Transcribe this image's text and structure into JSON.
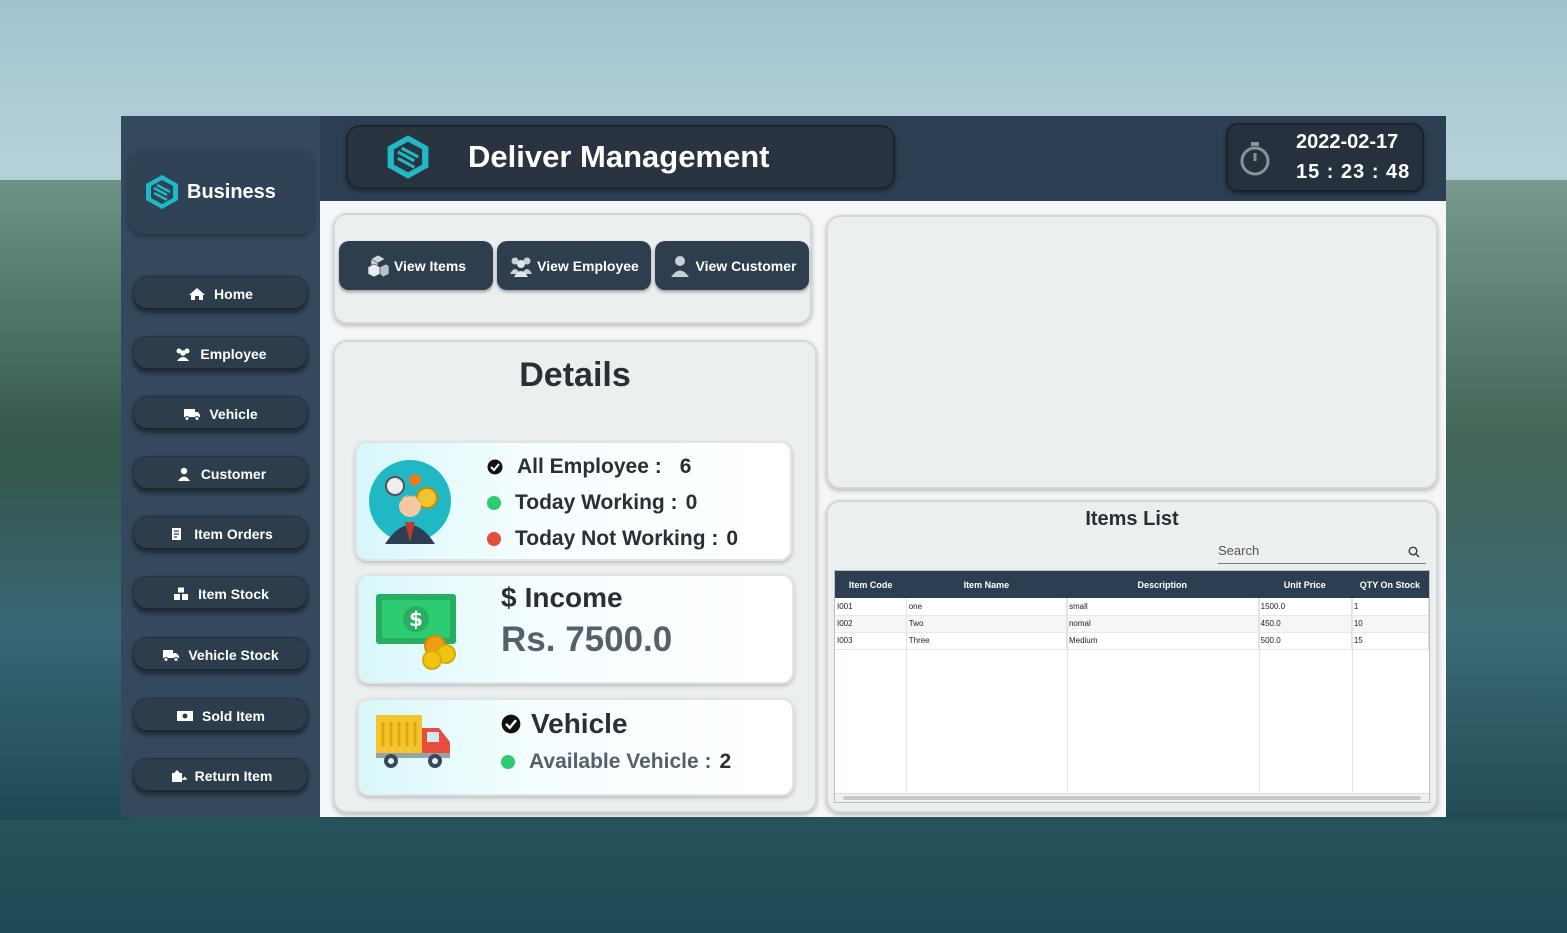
{
  "brand": {
    "name": "Business"
  },
  "sidebar": {
    "items": [
      {
        "label": "Home",
        "icon": "home-icon"
      },
      {
        "label": "Employee",
        "icon": "users-icon"
      },
      {
        "label": "Vehicle",
        "icon": "truck-icon"
      },
      {
        "label": "Customer",
        "icon": "user-icon"
      },
      {
        "label": "Item Orders",
        "icon": "orders-icon"
      },
      {
        "label": "Item Stock",
        "icon": "boxes-icon"
      },
      {
        "label": "Vehicle Stock",
        "icon": "truck-stock-icon"
      },
      {
        "label": "Sold Item",
        "icon": "money-icon"
      },
      {
        "label": "Return Item",
        "icon": "return-icon"
      }
    ]
  },
  "header": {
    "title": "Deliver Management",
    "date": "2022-02-17",
    "time": "15 : 23 : 48"
  },
  "quick_actions": [
    {
      "label": "View Items",
      "icon": "boxes-icon"
    },
    {
      "label": "View Employee",
      "icon": "users-icon"
    },
    {
      "label": "View Customer",
      "icon": "user-icon"
    }
  ],
  "details": {
    "title": "Details",
    "employees": {
      "all_label": "All Employee :",
      "all_value": "6",
      "working_label": "Today Working :",
      "working_value": "0",
      "not_working_label": "Today Not Working :",
      "not_working_value": "0"
    },
    "income": {
      "label": "Income",
      "currency_symbol": "$",
      "value": "Rs. 7500.0"
    },
    "vehicle": {
      "label": "Vehicle",
      "available_label": "Available Vehicle :",
      "available_value": "2"
    }
  },
  "items_list": {
    "title": "Items List",
    "search_placeholder": "Search",
    "columns": [
      "Item Code",
      "Item Name",
      "Description",
      "Unit Price",
      "QTY On Stock"
    ],
    "rows": [
      [
        "I001",
        "one",
        "small",
        "1500.0",
        "1"
      ],
      [
        "I002",
        "Two",
        "nomal",
        "450.0",
        "10"
      ],
      [
        "I003",
        "Three",
        "Medium",
        "500.0",
        "15"
      ]
    ]
  },
  "colors": {
    "sidebar_bg": "#34495e",
    "header_bg": "#2c3e52",
    "accent_teal": "#1fb8c4",
    "status_green": "#2ecc71",
    "status_red": "#e74c3c"
  }
}
